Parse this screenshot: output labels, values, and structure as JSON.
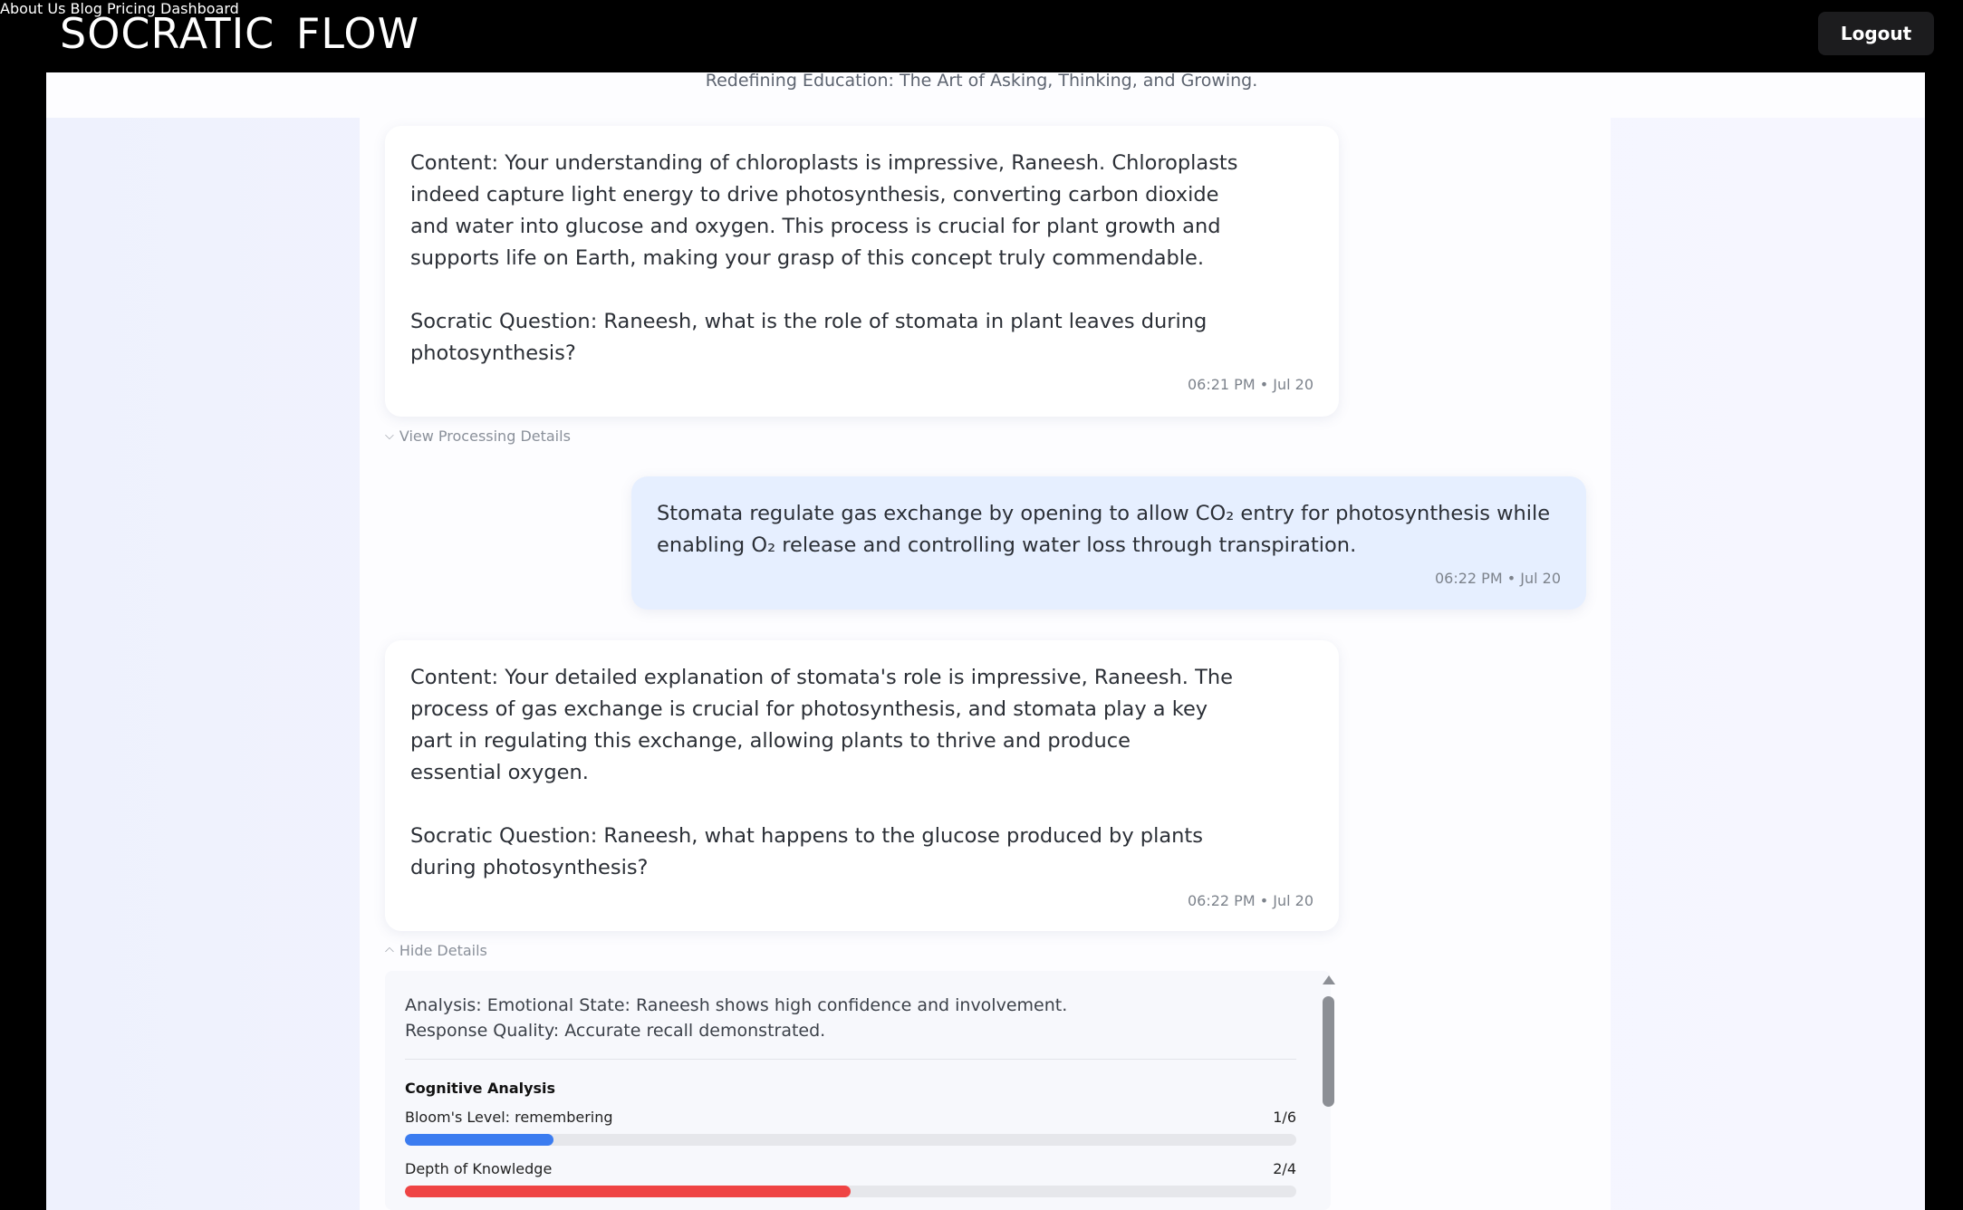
{
  "header": {
    "brand": "SOCRATIC FLOW",
    "nav": [
      "About Us",
      "Blog",
      "Pricing",
      "Dashboard"
    ],
    "logout": "Logout"
  },
  "tagline": "Redefining Education: The Art of Asking, Thinking, and Growing.",
  "messages": [
    {
      "role": "ai",
      "text": "Content: Your understanding of chloroplasts is impressive, Raneesh. Chloroplasts\nindeed capture light energy to drive photosynthesis, converting carbon dioxide\nand water into glucose and oxygen. This process is crucial for plant growth and\nsupports life on Earth, making your grasp of this concept truly commendable.\n\nSocratic Question: Raneesh, what is the role of stomata in plant leaves during\nphotosynthesis?",
      "time": "06:21 PM • Jul 20",
      "toggle": "View Processing Details"
    },
    {
      "role": "user",
      "text": "Stomata regulate gas exchange by opening to allow CO₂ entry for photosynthesis while\nenabling O₂ release and controlling water loss through transpiration.",
      "time": "06:22 PM • Jul 20"
    },
    {
      "role": "ai",
      "text": "Content: Your detailed explanation of stomata's role is impressive, Raneesh. The\nprocess of gas exchange is crucial for photosynthesis, and stomata play a key\npart in regulating this exchange, allowing plants to thrive and produce\nessential oxygen.\n\nSocratic Question: Raneesh, what happens to the glucose produced by plants\nduring photosynthesis?",
      "time": "06:22 PM • Jul 20",
      "toggle": "Hide Details"
    }
  ],
  "details": {
    "analysis": "Analysis: Emotional State: Raneesh shows high confidence and involvement.\nResponse Quality: Accurate recall demonstrated.",
    "heading": "Cognitive Analysis",
    "metrics": [
      {
        "label": "Bloom's Level: remembering",
        "score": "1/6",
        "fraction": 0.1667,
        "color": "#3b7cf0"
      },
      {
        "label": "Depth of Knowledge",
        "score": "2/4",
        "fraction": 0.5,
        "color": "#ef4444"
      }
    ]
  },
  "icons": {
    "view_details": "chevron-down-icon",
    "hide_details": "chevron-up-icon",
    "scroll": "scroll-up-arrow-icon"
  }
}
